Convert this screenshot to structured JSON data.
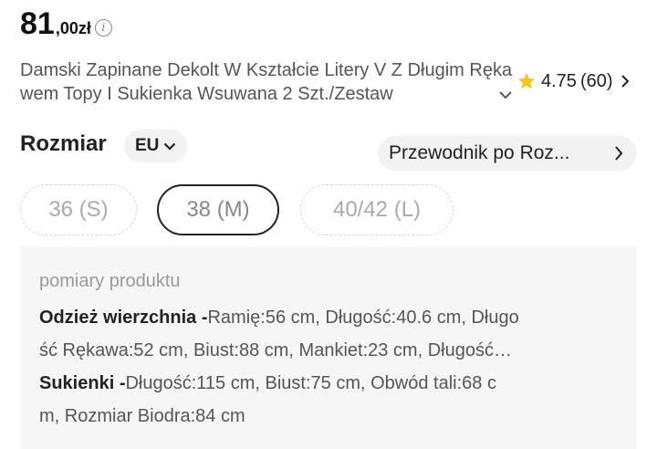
{
  "price": {
    "integer": "81",
    "decimal": ",00zł"
  },
  "product": {
    "title": "Damski Zapinane Dekolt W Kształcie Litery V Z Długim Rękawem Topy I Sukienka Wsuwana 2 Szt./Zestaw"
  },
  "rating": {
    "value": "4.75",
    "count": "(60)",
    "star_color": "#f5c518"
  },
  "size": {
    "label": "Rozmiar",
    "region": "EU",
    "guide_label": "Przewodnik po Roz...",
    "options": [
      {
        "label": "36 (S)",
        "state": "disabled"
      },
      {
        "label": "38 (M)",
        "state": "selected"
      },
      {
        "label": "40/42 (L)",
        "state": "disabled"
      }
    ]
  },
  "measurements": {
    "title": "pomiary produktu",
    "lines": [
      {
        "label": "Odzież wierzchnia -",
        "text": "Ramię:56 cm,  Długość:40.6 cm,  Długo"
      },
      {
        "label": "",
        "text": "ść Rękawa:52 cm,  Biust:88 cm,  Mankiet:23 cm,  Długość…"
      },
      {
        "label": "Sukienki -",
        "text": "Długość:115 cm,  Biust:75 cm,  Obwód tali:68 c"
      },
      {
        "label": "",
        "text": "m,  Rozmiar Biodra:84 cm"
      }
    ]
  }
}
